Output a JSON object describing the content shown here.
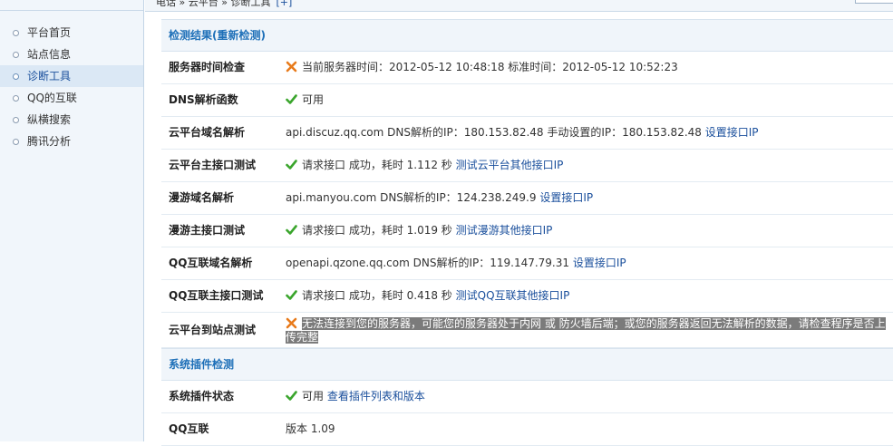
{
  "topbar": {
    "crumb": "电话 » 云平台 » 诊断工具",
    "crumb_link": "[+]"
  },
  "sidebar": {
    "items": [
      {
        "label": "平台首页",
        "active": false
      },
      {
        "label": "站点信息",
        "active": false
      },
      {
        "label": "诊断工具",
        "active": true
      },
      {
        "label": "QQ的互联",
        "active": false
      },
      {
        "label": "纵横搜索",
        "active": false
      },
      {
        "label": "腾讯分析",
        "active": false
      }
    ]
  },
  "sections": {
    "check_result": {
      "title": "检测结果(重新检测)"
    },
    "plugin_check": {
      "title": "系统插件检测"
    }
  },
  "rows": {
    "server_time": {
      "label": "服务器时间检查",
      "status_icon": "cross-icon",
      "text": "当前服务器时间：2012-05-12 10:48:18 标准时间：2012-05-12 10:52:23"
    },
    "dns_func": {
      "label": "DNS解析函数",
      "status_icon": "check-icon",
      "text": "可用"
    },
    "cloud_domain": {
      "label": "云平台域名解析",
      "text": "api.discuz.qq.com DNS解析的IP：180.153.82.48 手动设置的IP：180.153.82.48",
      "link": "设置接口IP"
    },
    "cloud_api": {
      "label": "云平台主接口测试",
      "status_icon": "check-icon",
      "text": "请求接口 成功，耗时 1.112 秒",
      "link": "测试云平台其他接口IP"
    },
    "manyou_domain": {
      "label": "漫游域名解析",
      "text": "api.manyou.com DNS解析的IP：124.238.249.9",
      "link": "设置接口IP"
    },
    "manyou_api": {
      "label": "漫游主接口测试",
      "status_icon": "check-icon",
      "text": "请求接口 成功，耗时 1.019 秒",
      "link": "测试漫游其他接口IP"
    },
    "qq_domain": {
      "label": "QQ互联域名解析",
      "text": "openapi.qzone.qq.com DNS解析的IP：119.147.79.31",
      "link": "设置接口IP"
    },
    "qq_api": {
      "label": "QQ互联主接口测试",
      "status_icon": "check-icon",
      "text": "请求接口 成功，耗时 0.418 秒",
      "link": "测试QQ互联其他接口IP"
    },
    "cloud_to_site": {
      "label": "云平台到站点测试",
      "status_icon": "cross-icon",
      "text": "无法连接到您的服务器，可能您的服务器处于内网 或 防火墙后端；或您的服务器返回无法解析的数据，请检查程序是否上传完整"
    },
    "plugin_status": {
      "label": "系统插件状态",
      "status_icon": "check-icon",
      "text": "可用",
      "link": "查看插件列表和版本"
    },
    "qq_connect": {
      "label": "QQ互联",
      "text": "版本 1.09"
    }
  },
  "colors": {
    "accent": "#1d6fb8",
    "link": "#1a4f9c",
    "ok": "#3aa52c",
    "error": "#e87a1a",
    "highlight": "#7b7b7b"
  }
}
